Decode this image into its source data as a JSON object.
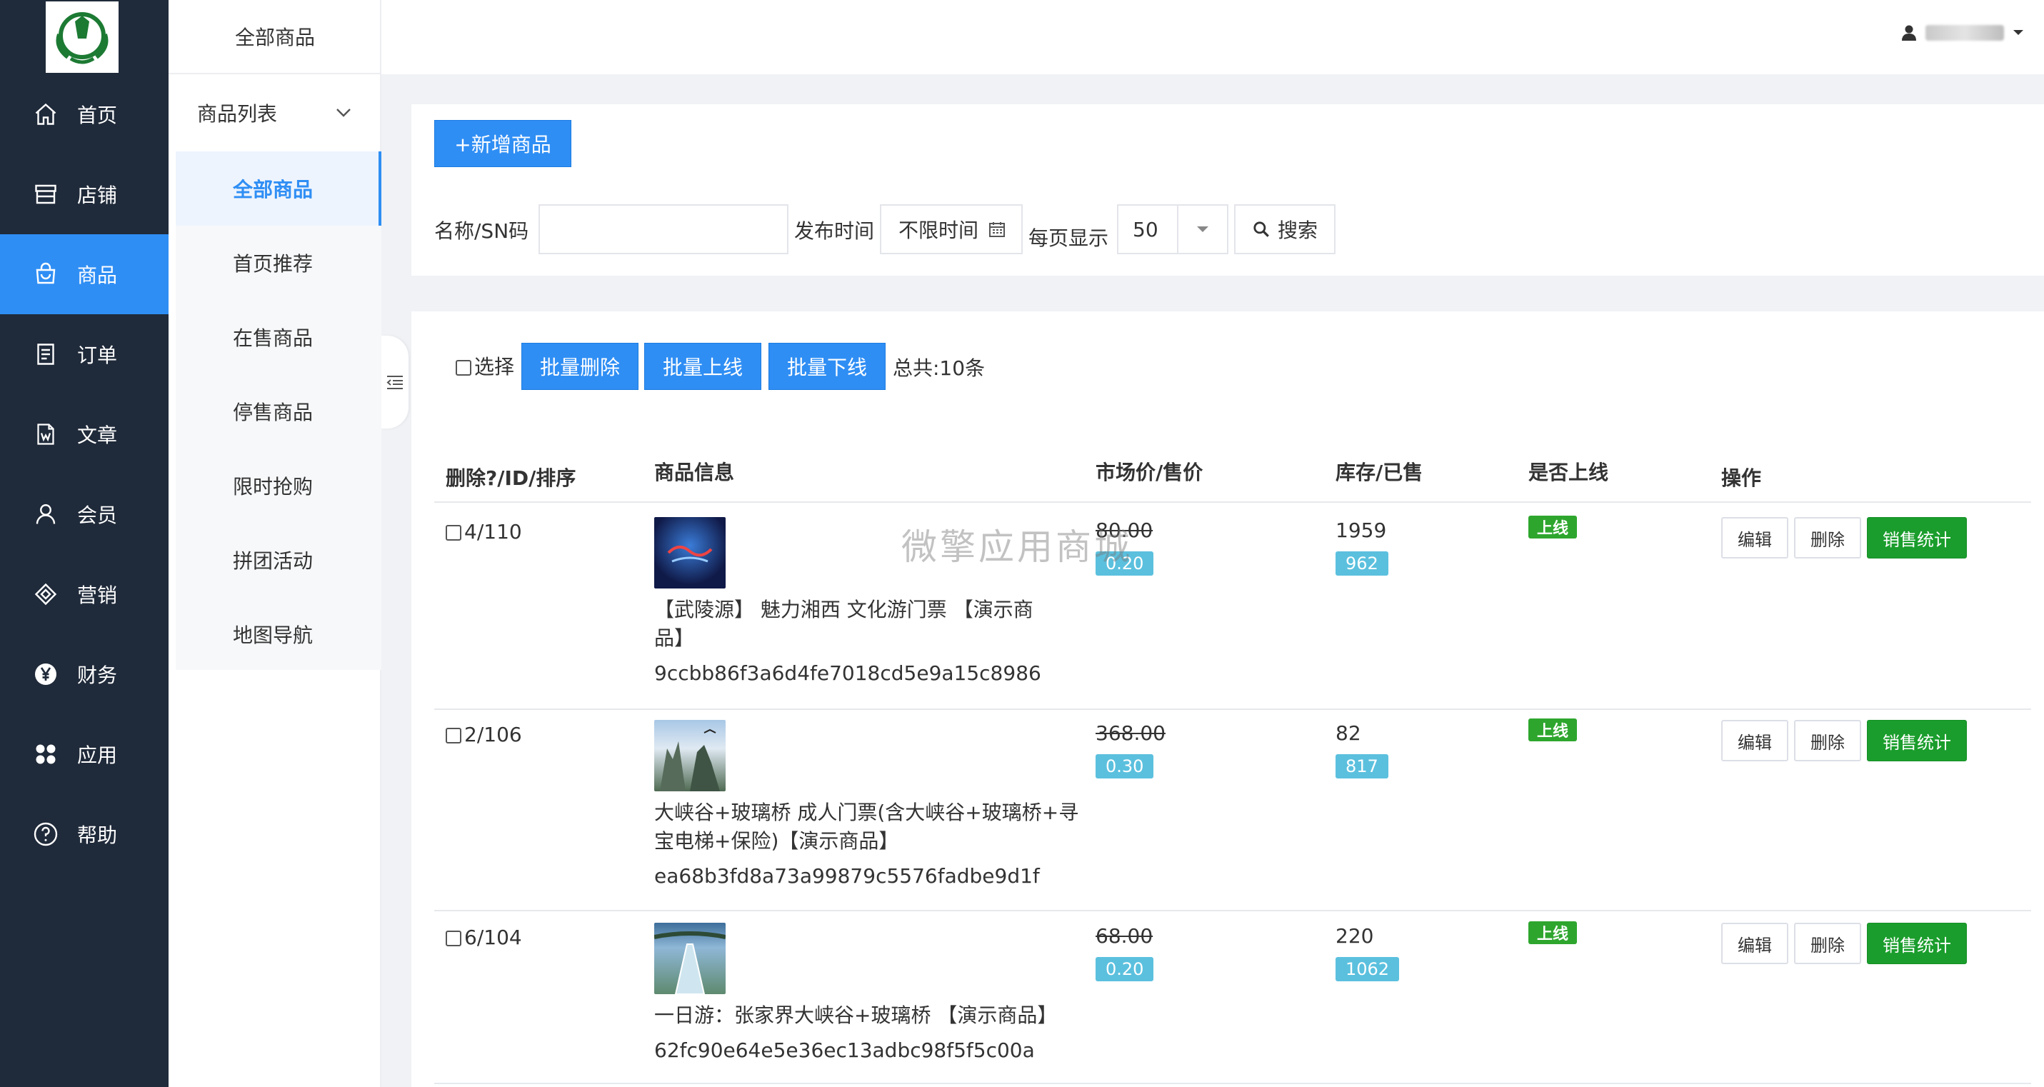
{
  "nav": {
    "items": [
      {
        "label": "首页",
        "icon": "home-icon"
      },
      {
        "label": "店铺",
        "icon": "store-icon"
      },
      {
        "label": "商品",
        "icon": "shopping-bag-icon"
      },
      {
        "label": "订单",
        "icon": "order-icon"
      },
      {
        "label": "文章",
        "icon": "article-icon"
      },
      {
        "label": "会员",
        "icon": "user-icon"
      },
      {
        "label": "营销",
        "icon": "marketing-icon"
      },
      {
        "label": "财务",
        "icon": "yen-icon"
      },
      {
        "label": "应用",
        "icon": "apps-icon"
      },
      {
        "label": "帮助",
        "icon": "help-icon"
      }
    ],
    "active": "商品",
    "accent": "#2f8ef4",
    "background": "#1f2a3a"
  },
  "submenu": {
    "title": "全部商品",
    "group_label": "商品列表",
    "items": [
      "全部商品",
      "首页推荐",
      "在售商品",
      "停售商品",
      "限时抢购",
      "拼团活动",
      "地图导航"
    ],
    "active": "全部商品"
  },
  "filter": {
    "add_button": "+新增商品",
    "name_label": "名称/SN码",
    "name_value": "",
    "time_label": "发布时间",
    "time_value": "不限时间",
    "per_page_label": "每页显示",
    "per_page_value": "50",
    "search_button": "搜索"
  },
  "bulk": {
    "select_label": "选择",
    "delete_button": "批量删除",
    "online_button": "批量上线",
    "offline_button": "批量下线",
    "total": "总共:10条"
  },
  "table": {
    "headers": [
      "删除?/ID/排序",
      "商品信息",
      "市场价/售价",
      "库存/已售",
      "是否上线",
      "操作"
    ],
    "rows": [
      {
        "id_sort": "4/110",
        "name": "【武陵源】 魅力湘西 文化游门票 【演示商品】",
        "name_line1": "【武陵源】 魅力湘西 文化游门票 【演示商",
        "name_line2": "品】",
        "sn": "9ccbb86f3a6d4fe7018cd5e9a15c8986",
        "market_price": "80.00",
        "price": "0.20",
        "stock": "1959",
        "sold": "962",
        "status": "上线"
      },
      {
        "id_sort": "2/106",
        "name": "大峡谷+玻璃桥 成人门票(含大峡谷+玻璃桥+寻宝电梯+保险)【演示商品】",
        "name_line1": "大峡谷+玻璃桥 成人门票(含大峡谷+玻璃桥+寻",
        "name_line2": "宝电梯+保险)【演示商品】",
        "sn": "ea68b3fd8a73a99879c5576fadbe9d1f",
        "market_price": "368.00",
        "price": "0.30",
        "stock": "82",
        "sold": "817",
        "status": "上线"
      },
      {
        "id_sort": "6/104",
        "name": "一日游：张家界大峡谷+玻璃桥 【演示商品】",
        "name_line1": "一日游：张家界大峡谷+玻璃桥 【演示商品】",
        "name_line2": "",
        "sn": "62fc90e64e5e36ec13adbc98f5f5c00a",
        "market_price": "68.00",
        "price": "0.20",
        "stock": "220",
        "sold": "1062",
        "status": "上线"
      }
    ],
    "actions": {
      "edit": "编辑",
      "delete": "删除",
      "stats": "销售统计"
    }
  },
  "watermark": "微擎应用商城"
}
